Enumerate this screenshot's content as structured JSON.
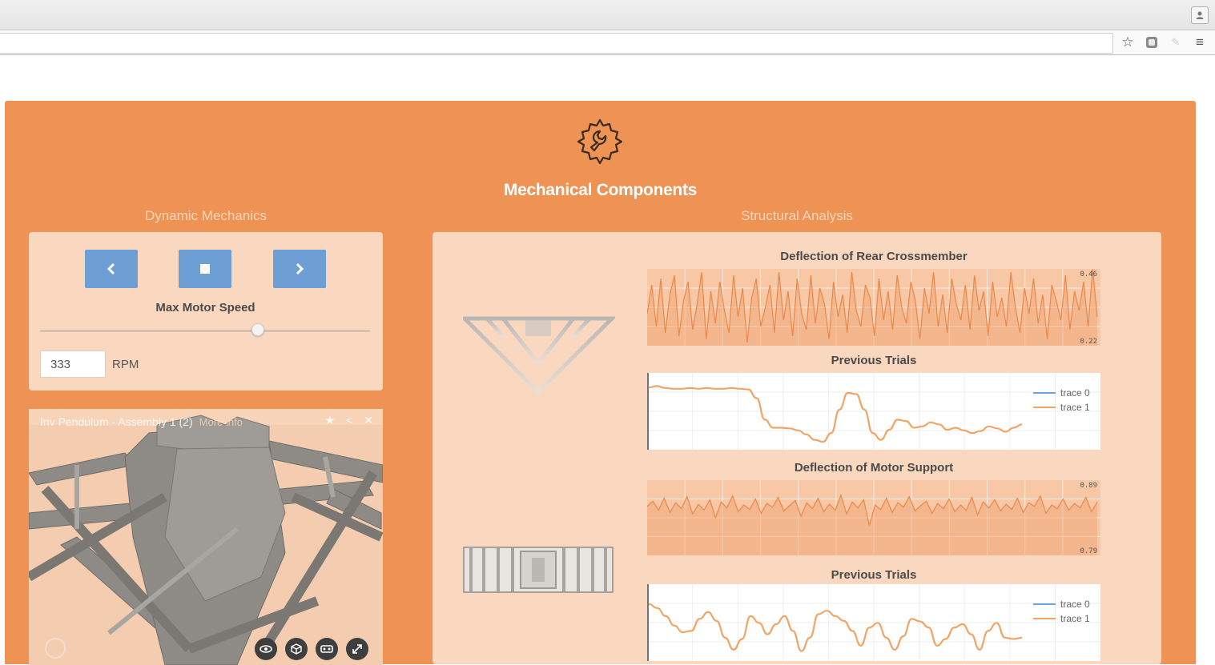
{
  "header": {
    "title": "Mechanical Components"
  },
  "dynamic": {
    "section_title": "Dynamic Mechanics",
    "speed_label": "Max Motor Speed",
    "speed_fraction": 0.66,
    "rpm_value": "333",
    "rpm_unit": "RPM"
  },
  "viewer": {
    "title": "Inv Pendulum - Assembly 1 (2)",
    "more_info": "More info"
  },
  "structural": {
    "section_title": "Structural Analysis",
    "charts": [
      {
        "title": "Deflection of Rear Crossmember",
        "ymax_label": "0.46",
        "ymin_label": "0.22"
      },
      {
        "title": "Previous Trials",
        "legend": [
          "trace 0",
          "trace 1"
        ]
      },
      {
        "title": "Deflection of Motor Support",
        "ymax_label": "0.89",
        "ymin_label": "0.79"
      },
      {
        "title": "Previous Trials",
        "legend": [
          "trace 0",
          "trace 1"
        ]
      }
    ]
  },
  "colors": {
    "panel": "#ee9354",
    "card": "#fad8c0",
    "button": "#6d9fd4",
    "trace0": "#6fa4d8",
    "trace1": "#f0a566"
  },
  "chart_data": [
    {
      "type": "area",
      "title": "Deflection of Rear Crossmember",
      "ylim": [
        0.22,
        0.46
      ],
      "grid": true,
      "series": [
        {
          "values": [
            0.32,
            0.41,
            0.28,
            0.43,
            0.26,
            0.38,
            0.44,
            0.25,
            0.36,
            0.42,
            0.27,
            0.35,
            0.45,
            0.24,
            0.39,
            0.29,
            0.42,
            0.33,
            0.26,
            0.44,
            0.31,
            0.4,
            0.23,
            0.37,
            0.43,
            0.28,
            0.34,
            0.41,
            0.26,
            0.45,
            0.3,
            0.39,
            0.25,
            0.43,
            0.32,
            0.27,
            0.44,
            0.29,
            0.4,
            0.35,
            0.24,
            0.42,
            0.31,
            0.38,
            0.26,
            0.45,
            0.33,
            0.28,
            0.41,
            0.37,
            0.25,
            0.43,
            0.3,
            0.39,
            0.27,
            0.44,
            0.34,
            0.29,
            0.42,
            0.36,
            0.24,
            0.4,
            0.32,
            0.45,
            0.28,
            0.38,
            0.26,
            0.43,
            0.35,
            0.3,
            0.41,
            0.27,
            0.44,
            0.33,
            0.39,
            0.25,
            0.42,
            0.31,
            0.37,
            0.28,
            0.45,
            0.34,
            0.26,
            0.4,
            0.32,
            0.43,
            0.29,
            0.38,
            0.24,
            0.41,
            0.36,
            0.3,
            0.44,
            0.27,
            0.39,
            0.33,
            0.42,
            0.28,
            0.46,
            0.31
          ]
        }
      ]
    },
    {
      "type": "line",
      "title": "Previous Trials",
      "series": [
        {
          "name": "trace 0",
          "values": []
        },
        {
          "name": "trace 1",
          "values": [
            0.88,
            0.9,
            0.87,
            0.86,
            0.86,
            0.87,
            0.86,
            0.87,
            0.86,
            0.86,
            0.87,
            0.86,
            0.85,
            0.72,
            0.4,
            0.28,
            0.28,
            0.27,
            0.24,
            0.18,
            0.1,
            0.07,
            0.2,
            0.55,
            0.8,
            0.78,
            0.55,
            0.2,
            0.1,
            0.25,
            0.4,
            0.38,
            0.28,
            0.3,
            0.36,
            0.33,
            0.25,
            0.28,
            0.24,
            0.2,
            0.23,
            0.3,
            0.27,
            0.22,
            0.28,
            0.33
          ]
        }
      ]
    },
    {
      "type": "area",
      "title": "Deflection of Motor Support",
      "ylim": [
        0.79,
        0.89
      ],
      "grid": true,
      "series": [
        {
          "values": [
            0.855,
            0.862,
            0.85,
            0.866,
            0.847,
            0.86,
            0.852,
            0.868,
            0.845,
            0.858,
            0.85,
            0.864,
            0.84,
            0.861,
            0.853,
            0.869,
            0.848,
            0.857,
            0.851,
            0.865,
            0.846,
            0.859,
            0.854,
            0.867,
            0.849,
            0.856,
            0.863,
            0.842,
            0.86,
            0.852,
            0.866,
            0.848,
            0.858,
            0.85,
            0.87,
            0.845,
            0.861,
            0.853,
            0.864,
            0.83,
            0.857,
            0.851,
            0.866,
            0.847,
            0.86,
            0.854,
            0.868,
            0.849,
            0.856,
            0.862,
            0.846,
            0.859,
            0.852,
            0.865,
            0.848,
            0.857,
            0.85,
            0.867,
            0.844,
            0.861,
            0.853,
            0.864,
            0.849,
            0.858,
            0.851,
            0.866,
            0.847,
            0.86,
            0.855,
            0.869,
            0.846,
            0.857,
            0.852,
            0.865,
            0.85,
            0.859,
            0.853,
            0.867,
            0.848,
            0.861
          ]
        }
      ]
    },
    {
      "type": "line",
      "title": "Previous Trials",
      "series": [
        {
          "name": "trace 0",
          "values": []
        },
        {
          "name": "trace 1",
          "values": [
            0.8,
            0.74,
            0.62,
            0.48,
            0.38,
            0.4,
            0.58,
            0.68,
            0.55,
            0.3,
            0.12,
            0.28,
            0.62,
            0.52,
            0.35,
            0.5,
            0.62,
            0.4,
            0.1,
            0.3,
            0.65,
            0.7,
            0.62,
            0.55,
            0.4,
            0.18,
            0.45,
            0.52,
            0.3,
            0.12,
            0.32,
            0.58,
            0.54,
            0.45,
            0.18,
            0.28,
            0.45,
            0.5,
            0.35,
            0.12,
            0.4,
            0.52,
            0.3,
            0.28,
            0.3
          ]
        }
      ]
    }
  ]
}
